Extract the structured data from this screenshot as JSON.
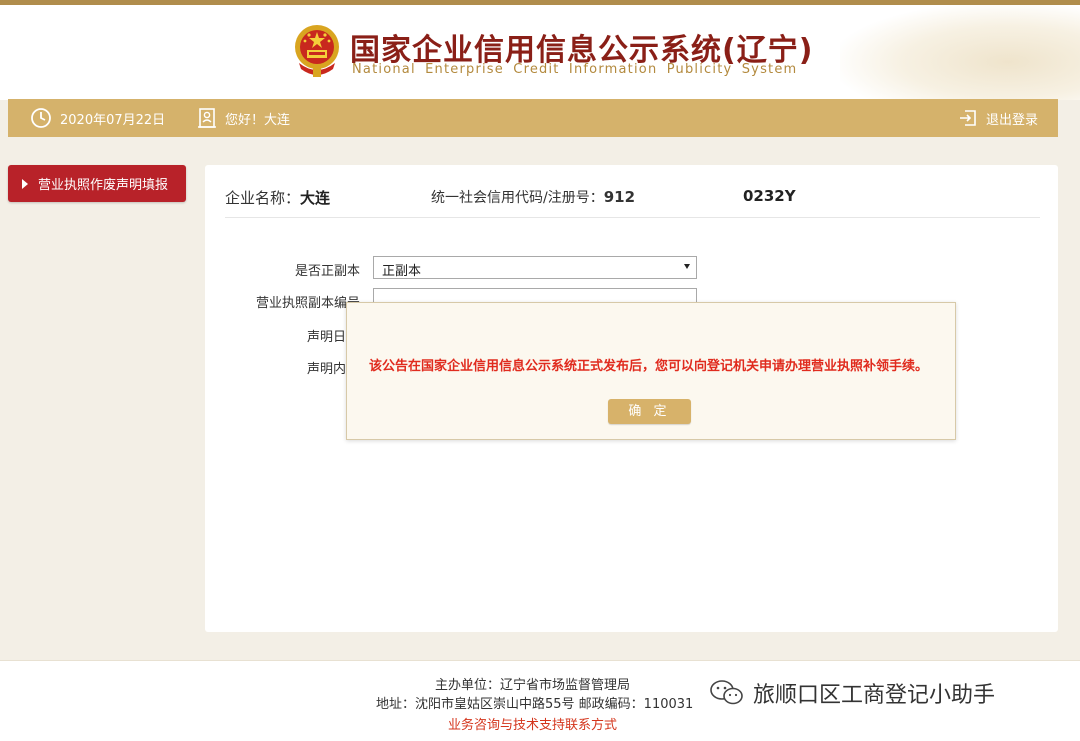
{
  "header": {
    "title_cn": "国家企业信用信息公示系统(辽宁)",
    "title_en": "National Enterprise Credit Information Publicity System",
    "emblem_icon": "national-emblem-icon"
  },
  "toolbar": {
    "date": "2020年07月22日",
    "greeting": "您好！大连",
    "logout": "退出登录"
  },
  "sidebar": {
    "items": [
      {
        "label": "营业执照作废声明填报"
      }
    ]
  },
  "company": {
    "name_label": "企业名称：",
    "name_value": "大连",
    "code_label": "统一社会信用代码/注册号：",
    "code_value_start": "912",
    "code_value_end": "0232Y"
  },
  "form": {
    "copy_type_label": "是否正副本",
    "copy_type_value": "正副本",
    "copy_no_label": "营业执照副本编号",
    "date_label": "声明日期",
    "content_label": "声明内容"
  },
  "dialog": {
    "message": "该公告在国家企业信用信息公示系统正式发布后，您可以向登记机关申请办理营业执照补领手续。",
    "ok_label": "确 定"
  },
  "footer": {
    "sponsor": "主办单位：辽宁省市场监督管理局",
    "address": "地址：沈阳市皇姑区崇山中路55号  邮政编码：110031",
    "contact_link": "业务咨询与技术支持联系方式"
  },
  "watermark": {
    "text": "旅顺口区工商登记小助手",
    "icon": "wechat-icon"
  },
  "colors": {
    "brand_gold": "#d5b26b",
    "brand_red": "#b82229",
    "title_red": "#8a1f17",
    "alert_red": "#e02b1e"
  }
}
